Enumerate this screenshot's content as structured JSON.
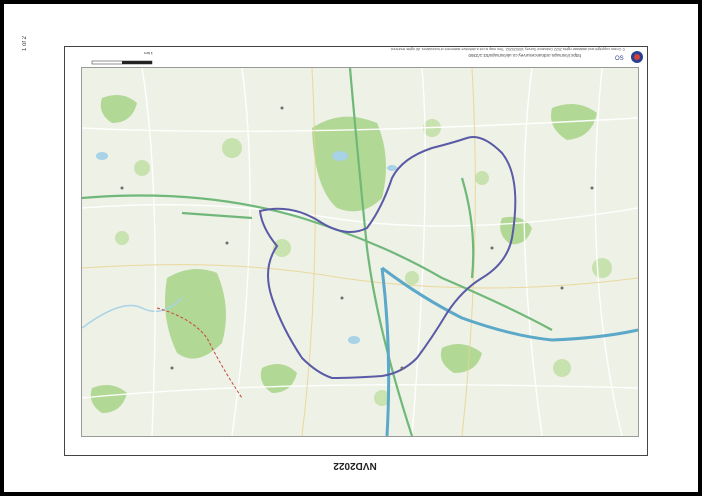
{
  "page_number": "1 of 2",
  "header_url": "https://osmaps.ordnancesurvey.co.uk/osmaps/53.1/3360",
  "copyright_notice": "© Crown copyright and database rights 2022 Ordnance Survey 100025252. This map is not a definitive statement of boundaries. All rights reserved.",
  "logo_label": "OS",
  "scale_label": "1 km",
  "map_code": "NVD2022",
  "colors": {
    "route": "#5a5aa6",
    "boundary": "#c8483c",
    "motorway": "#5ba8c8",
    "road_green": "#6fb87a",
    "woodland": "#9fcf7e",
    "water": "#a8d2e6",
    "land": "#eef1e6"
  }
}
